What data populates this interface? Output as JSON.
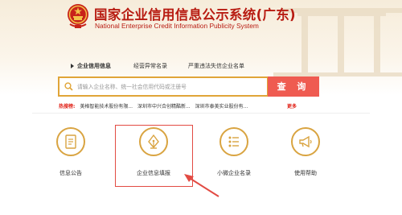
{
  "header": {
    "title_cn": "国家企业信用信息公示系统(广东)",
    "title_en": "National Enterprise Credit Information Publicity System"
  },
  "tabs": [
    {
      "label": "企业信用信息",
      "active": true
    },
    {
      "label": "经营异常名录",
      "active": false
    },
    {
      "label": "严重违法失信企业名单",
      "active": false
    }
  ],
  "search": {
    "placeholder": "请输入企业名称、统一社会信用代码或注册号",
    "button_label": "查 询"
  },
  "hotsearch": {
    "label": "热搜榜:",
    "items": [
      "美格智能技术股份有限...",
      "深圳市中兴合创精酷新...",
      "深圳市泰美实业股份有..."
    ],
    "more": "更多"
  },
  "functions": [
    {
      "label": "信息公告",
      "icon": "document-icon"
    },
    {
      "label": "企业信息填报",
      "icon": "pen-nib-icon"
    },
    {
      "label": "小微企业名录",
      "icon": "list-icon"
    },
    {
      "label": "使用帮助",
      "icon": "megaphone-icon"
    }
  ],
  "colors": {
    "brand_red": "#b81c12",
    "search_button": "#ef5b51",
    "gold": "#d9a441",
    "annotation_red": "#e24b43"
  }
}
